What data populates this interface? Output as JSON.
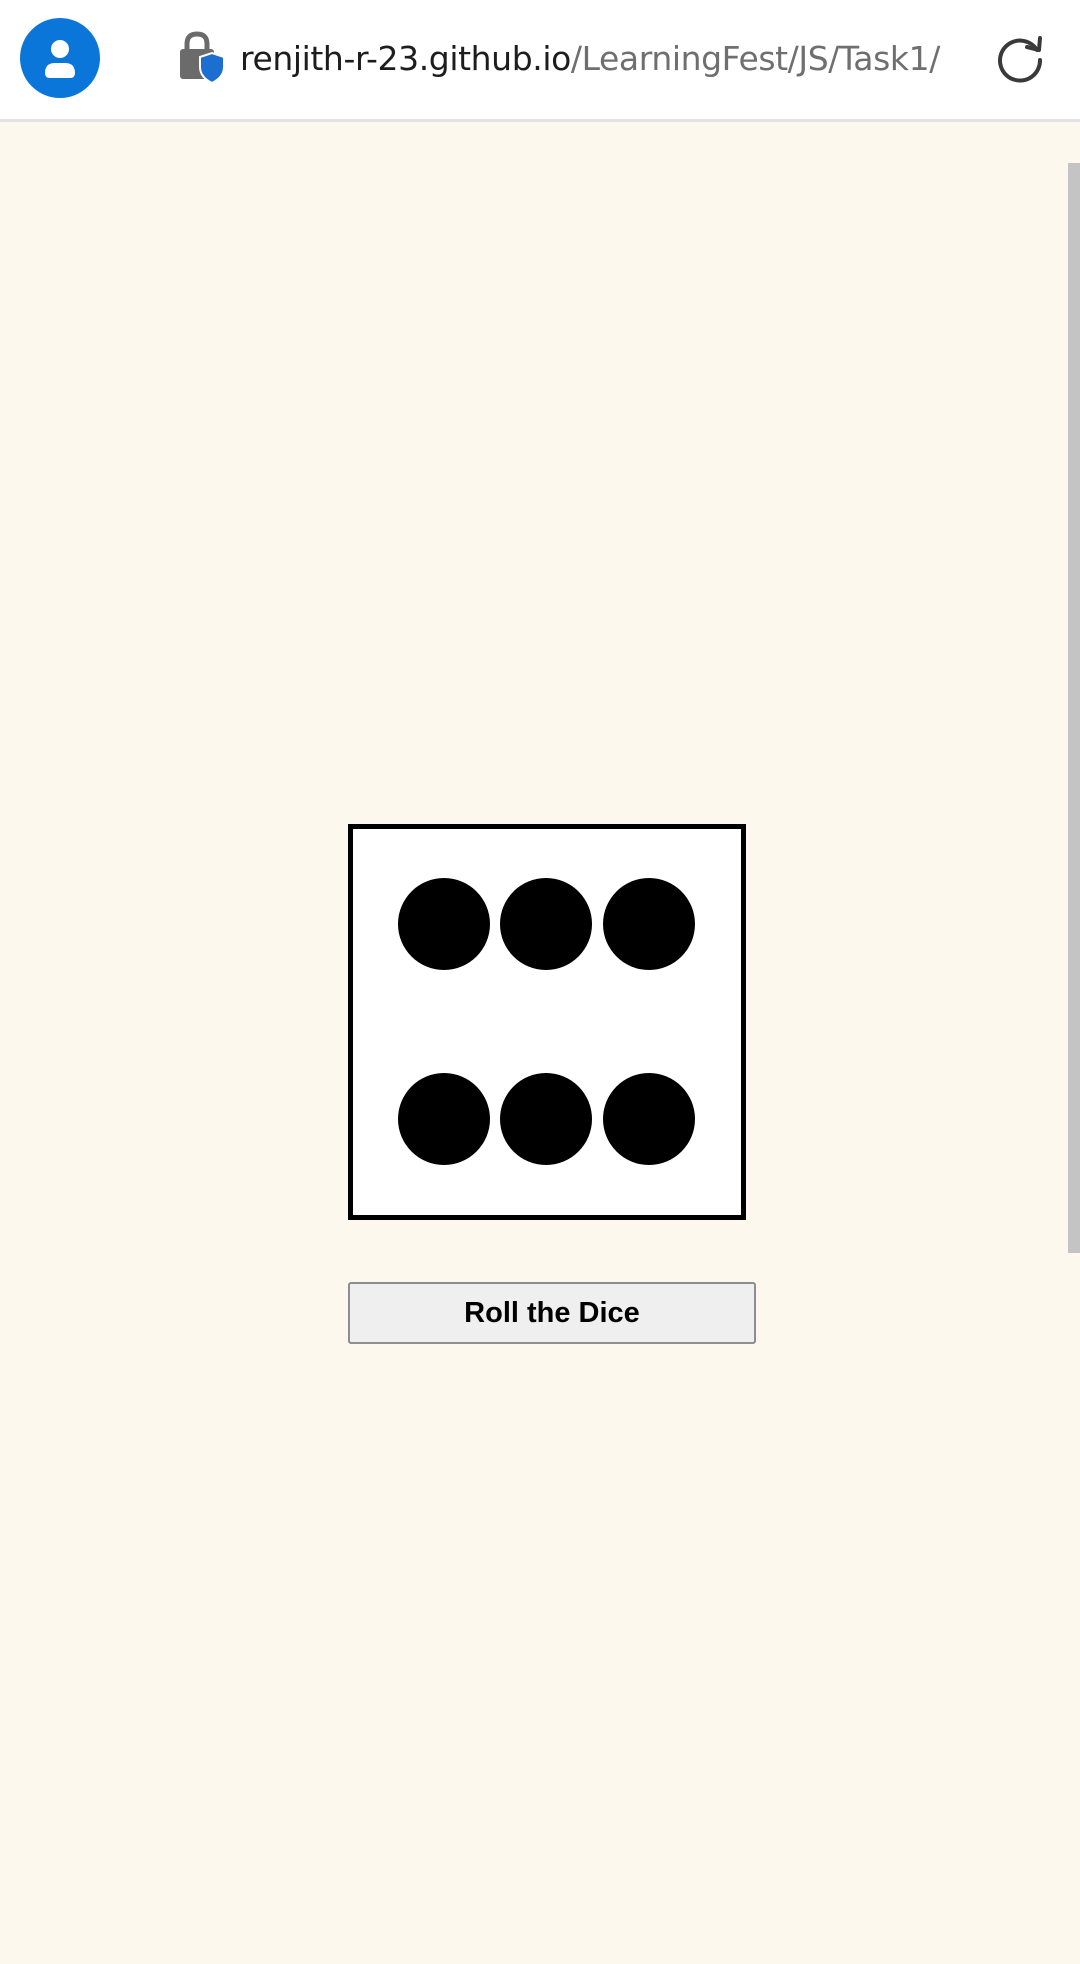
{
  "browser": {
    "url_domain": "renjith-r-23.github.io",
    "url_path": "/LearningFest/JS/Task1/",
    "icons": {
      "profile": "account-avatar-icon",
      "security": "lock-shield-icon",
      "reload": "reload-icon"
    },
    "colors": {
      "avatar": "#0b76d9",
      "shield": "#1c6fd1"
    }
  },
  "page": {
    "background": "#fcf8ed",
    "dice": {
      "value": 6
    },
    "roll_button_label": "Roll the Dice"
  }
}
